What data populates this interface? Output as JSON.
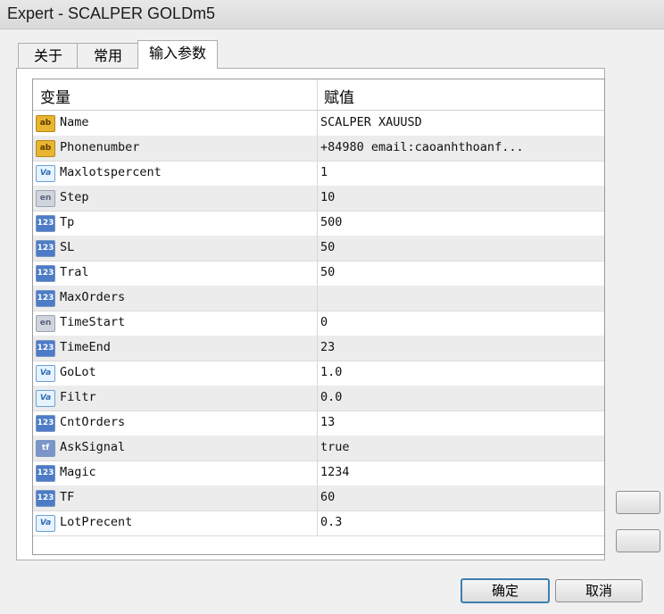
{
  "window": {
    "title": "Expert - SCALPER GOLDm5"
  },
  "tabs": [
    {
      "label": "关于"
    },
    {
      "label": "常用"
    },
    {
      "label": "输入参数"
    }
  ],
  "grid": {
    "headers": {
      "variable": "变量",
      "value": "赋值"
    },
    "rows": [
      {
        "type_icon": "ab",
        "name": "Name",
        "value": "SCALPER XAUUSD"
      },
      {
        "type_icon": "ab",
        "name": "Phonenumber",
        "value": "+84980     email:caoanhthoanf..."
      },
      {
        "type_icon": "Va",
        "name": "Maxlotspercent",
        "value": "1"
      },
      {
        "type_icon": "en",
        "name": "Step",
        "value": "10"
      },
      {
        "type_icon": "123",
        "name": "Tp",
        "value": "500"
      },
      {
        "type_icon": "123",
        "name": "SL",
        "value": "50"
      },
      {
        "type_icon": "123",
        "name": "Tral",
        "value": "50"
      },
      {
        "type_icon": "123",
        "name": "MaxOrders",
        "value": ""
      },
      {
        "type_icon": "en",
        "name": "TimeStart",
        "value": "0"
      },
      {
        "type_icon": "123",
        "name": "TimeEnd",
        "value": "23"
      },
      {
        "type_icon": "Va",
        "name": "GoLot",
        "value": "1.0"
      },
      {
        "type_icon": "Va",
        "name": "Filtr",
        "value": "0.0"
      },
      {
        "type_icon": "123",
        "name": "CntOrders",
        "value": "13"
      },
      {
        "type_icon": "tf",
        "name": "AskSignal",
        "value": "true"
      },
      {
        "type_icon": "123",
        "name": "Magic",
        "value": "1234"
      },
      {
        "type_icon": "123",
        "name": "TF",
        "value": "60"
      },
      {
        "type_icon": "Va",
        "name": "LotPrecent",
        "value": "0.3"
      }
    ]
  },
  "buttons": {
    "ok": "确定",
    "cancel": "取消"
  }
}
